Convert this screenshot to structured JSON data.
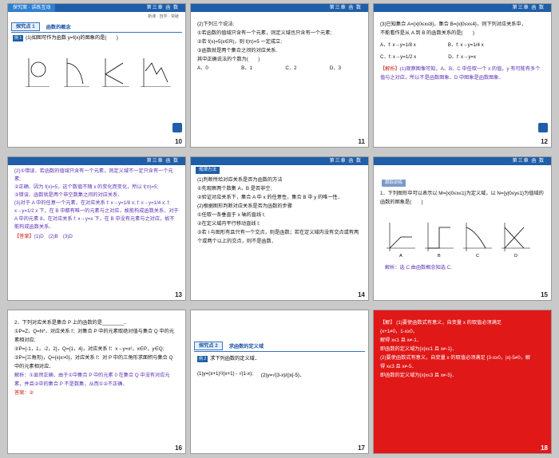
{
  "slides": [
    {
      "num": "10",
      "header_left": "探究案 · 讲练互动",
      "header_right": "第三章 函 数",
      "breadcrumb": "新课 · 自学 · 突破",
      "section_box": "探究点 1",
      "section_title": "函数的概念",
      "example_tag": "例 1",
      "question": "(1)如图可作为函数 y=f(x)的图象的是(　　)",
      "labels": [
        "A",
        "B",
        "C",
        "D"
      ]
    },
    {
      "num": "11",
      "header_right": "第三章 函 数",
      "lines": [
        "(2)下列三个说法:",
        "①若函数的值域只含有一个元素，则定义域也只含有一个元素;",
        "②若 f(x)=5(x∈R)，则 f(π)=5 一定成立;",
        "③函数就是两个集合之间的对应关系.",
        "其中正确说法的个数为(　　)"
      ],
      "options": [
        "A．0",
        "B．1",
        "C．2",
        "D．3"
      ]
    },
    {
      "num": "12",
      "header_right": "第三章 函 数",
      "lines": [
        "(3)已知集合 A={x|0≤x≤8}，集合 B={x|0≤x≤4}，则下列对应关系中，",
        "不能看作是从 A 到 B 的函数关系的是(　　)"
      ],
      "options": [
        "A．f: x→y=1/8 x",
        "B．f: x→y=1/4 x",
        "C．f: x→y=1/2 x",
        "D．f: x→y=x"
      ],
      "analysis_tag": "【解析】",
      "analysis": "(1)观察图像可知，A、B、C 中任取一个 x 的值，y 有可能有多个值与之对应，所以不是函数图象．D 中图象是函数图象．"
    },
    {
      "num": "13",
      "header_right": "第三章 函 数",
      "lines": [
        "(2)①错误．若函数的值域只含有一个元素，则定义域不一定只含有一个元素;",
        "②正确．因为 f(x)=5，这个数值不随 x 的变化而变化，所以 f(π)=5;",
        "③错误．函数就是两个非空数集之间的对应关系．",
        "(3)对于 A 中的任意一个元素，在对应关系 f: x→y=1/8 x; f: x→y=1/4 x; f: x→y=1/2 x 下，在 B 中都有唯一的元素与之对应，故能构成函数关系．对于 A 中的元素 8，在对应关系 f: x→y=x 下，在 B 中没有元素与之对应，故不能构成函数关系．"
      ],
      "answer_tag": "【答案】",
      "answer": "(1)D　(2)B　(3)D"
    },
    {
      "num": "14",
      "header_right": "第三章 函 数",
      "section_box": "规律方法",
      "lines": [
        "(1)判断所给对应关系是否为函数的方法",
        "①先观察两个数集 A，B 是否非空;",
        "②验证对应关系下，集合 A 中 x 的任意性，集合 B 中 y 的唯一性．",
        "(2)根据图形判断对应关系是否为函数的步骤",
        "①任取一条垂直于 x 轴的直线 l;",
        "②在定义域内平行移动直线 l;",
        "③若 l 与图形有且只有一个交点，则是函数；若在定义域内没有交点或有两个或两个以上的交点，则不是函数．"
      ]
    },
    {
      "num": "15",
      "header_right": "第三章 函 数",
      "section_box": "跟踪训练",
      "lines": [
        "1．下列图形中可以表示以 M={x|0≤x≤1}为定义域，以 N={y|0≤y≤1}为值域的函数的图象是(　　)"
      ],
      "labels": [
        "A",
        "B",
        "C",
        "D"
      ],
      "analysis": "解析：选 C.由函数概念知选 C."
    },
    {
      "num": "16",
      "lines": [
        "2．下列对应关系是集合 P 上的函数的是________．",
        "①P=Z，Q=N*，对应关系 f：对集合 P 中的元素取绝对值与集合 Q 中的元素相对应;",
        "②P={-1，1，-2，2}，Q={1，4}，对应关系 f：x→y=x²，x∈P，y∈Q;",
        "③P={三角形}，Q={x|x>0}，对应关系 f：对 P 中的三角形求面积与集合 Q 中的元素相对应．"
      ],
      "analysis": "解析：①显然正确．由于①中集合 P 中的元素 0 在集合 Q 中没有对应元素，并且②中的集合 P 不是数集，从而①②不正确．",
      "answer": "答案：②"
    },
    {
      "num": "17",
      "section_box": "探究点 2",
      "section_title": "求函数的定义域",
      "example_tag": "例 2",
      "question": "求下列函数的定义域．",
      "f1": "(1)y=(x+1)²/(x+1) - √(1-x);",
      "f2": "(2)y=√(3-x)/(|x|-5)．"
    },
    {
      "num": "18",
      "analysis_tag": "【解】",
      "lines": [
        "(1)要使函数式有意义，自变量 x 的取值必须满足",
        "{x+1≠0，1-x≥0，",
        "解得 x≤1 且 x≠-1．",
        "即函数的定义域为{x|x≤1 且 x≠-1}．",
        "(2)要使函数式有意义，自变量 x 的取值必须满足 {3-x≥0，|x|-5≠0，解",
        "得 x≤3 且 x≠-5．",
        "即函数的定义域为{x|x≤3 且 x≠-5}．"
      ]
    }
  ]
}
